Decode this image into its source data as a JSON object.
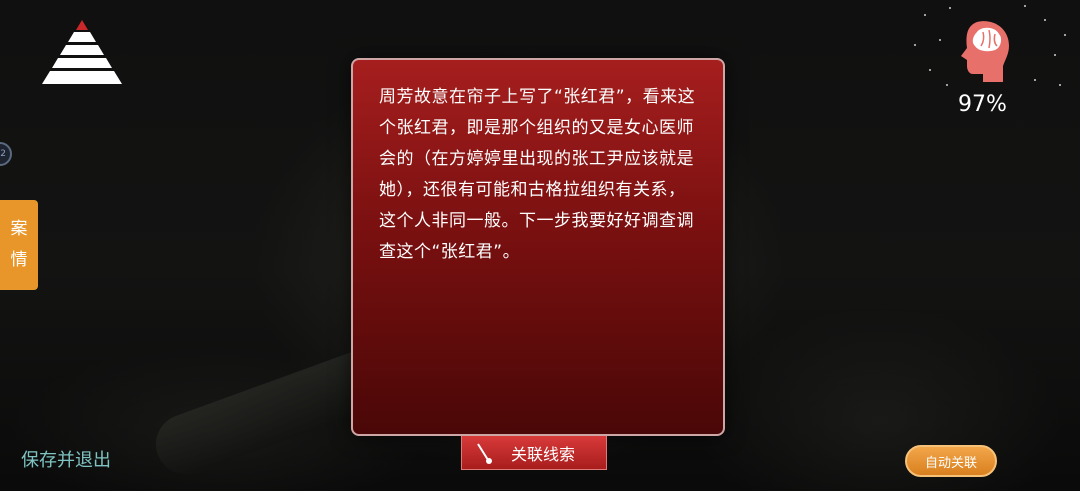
{
  "hud": {
    "pyramid_icon": "pyramid-level-icon",
    "case_tab": {
      "char1": "案",
      "char2": "情"
    },
    "save_exit_label": "保存并退出",
    "auto_link_label": "自动关联",
    "brain_icon": "head-brain-icon",
    "brain_percent": "97%",
    "brain_percent_value": 97
  },
  "dialog": {
    "text": "周芳故意在帘子上写了“张红君”，看来这个张红君，即是那个组织的又是女心医师会的（在方婷婷里出现的张工尹应该就是她），还很有可能和古格拉组织有关系，这个人非同一般。下一步我要好好调查调查这个“张红君”。",
    "link_button_label": "关联线索"
  },
  "colors": {
    "dialog_red": "#a61e1e",
    "accent_orange": "#e8962a",
    "save_teal": "#7fc4c2",
    "brain_pink": "#e8706a"
  }
}
